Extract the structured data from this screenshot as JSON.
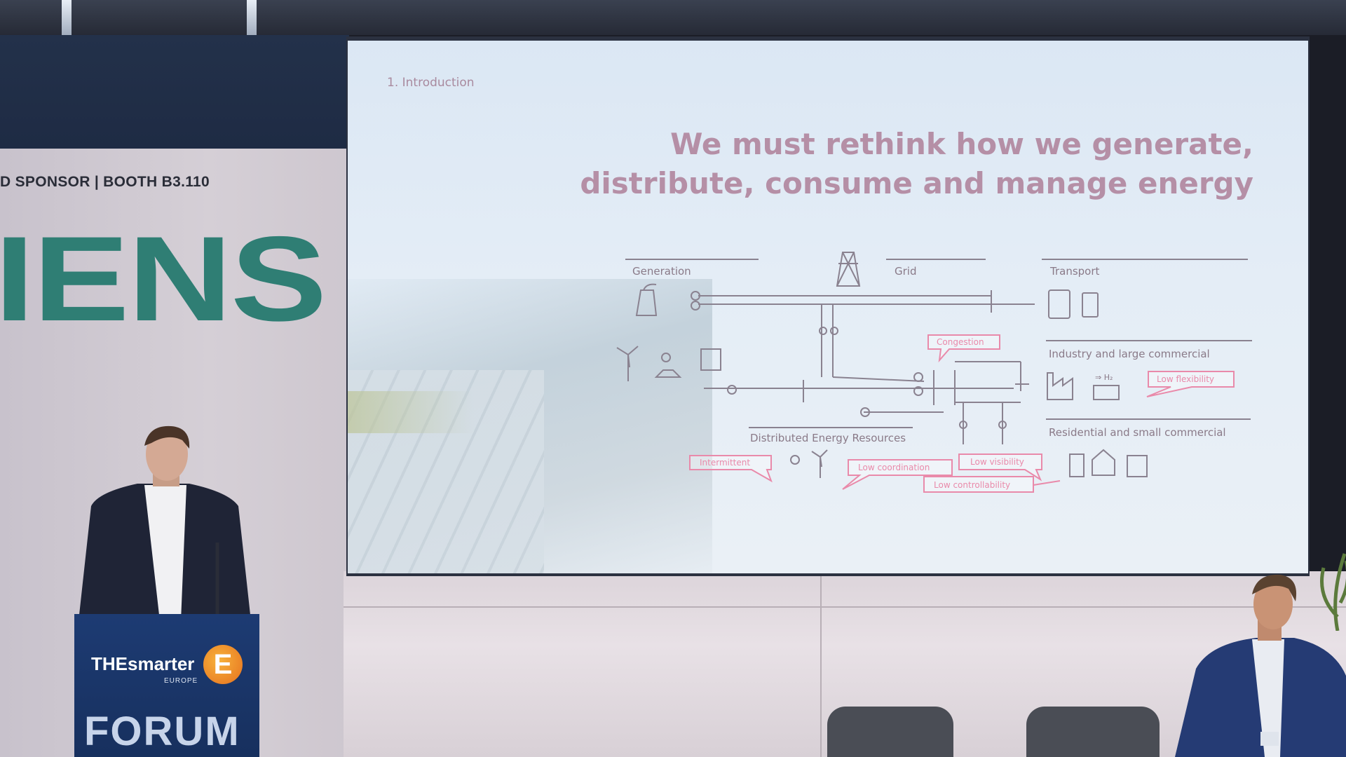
{
  "scene": {
    "booth_sponsor_text": "D SPONSOR | BOOTH B3.110",
    "booth_brand_fragment": "IENS",
    "podium": {
      "logo": "THEsmarter",
      "logo_sub": "EUROPE",
      "logo_mark": "E",
      "title": "FORUM"
    }
  },
  "slide": {
    "section": "1. Introduction",
    "headline_line1": "We must rethink how we generate,",
    "headline_line2": "distribute, consume and manage energy",
    "diagram": {
      "labels": {
        "generation": "Generation",
        "grid": "Grid",
        "transport": "Transport",
        "industry": "Industry and large commercial",
        "residential": "Residential and small commercial",
        "der": "Distributed Energy Resources"
      },
      "callouts": {
        "congestion": "Congestion",
        "low_flexibility": "Low flexibility",
        "intermittent": "Intermittent",
        "low_coordination": "Low coordination",
        "low_visibility": "Low visibility",
        "low_controllability": "Low controllability"
      },
      "h2_label": "⇒ H₂"
    }
  },
  "colors": {
    "brand_green": "#2f7e74",
    "booth_navy": "#1e2b44",
    "slide_title": "#b58fa6",
    "callout": "#e98aaa",
    "diagram_line": "#8a8290"
  }
}
